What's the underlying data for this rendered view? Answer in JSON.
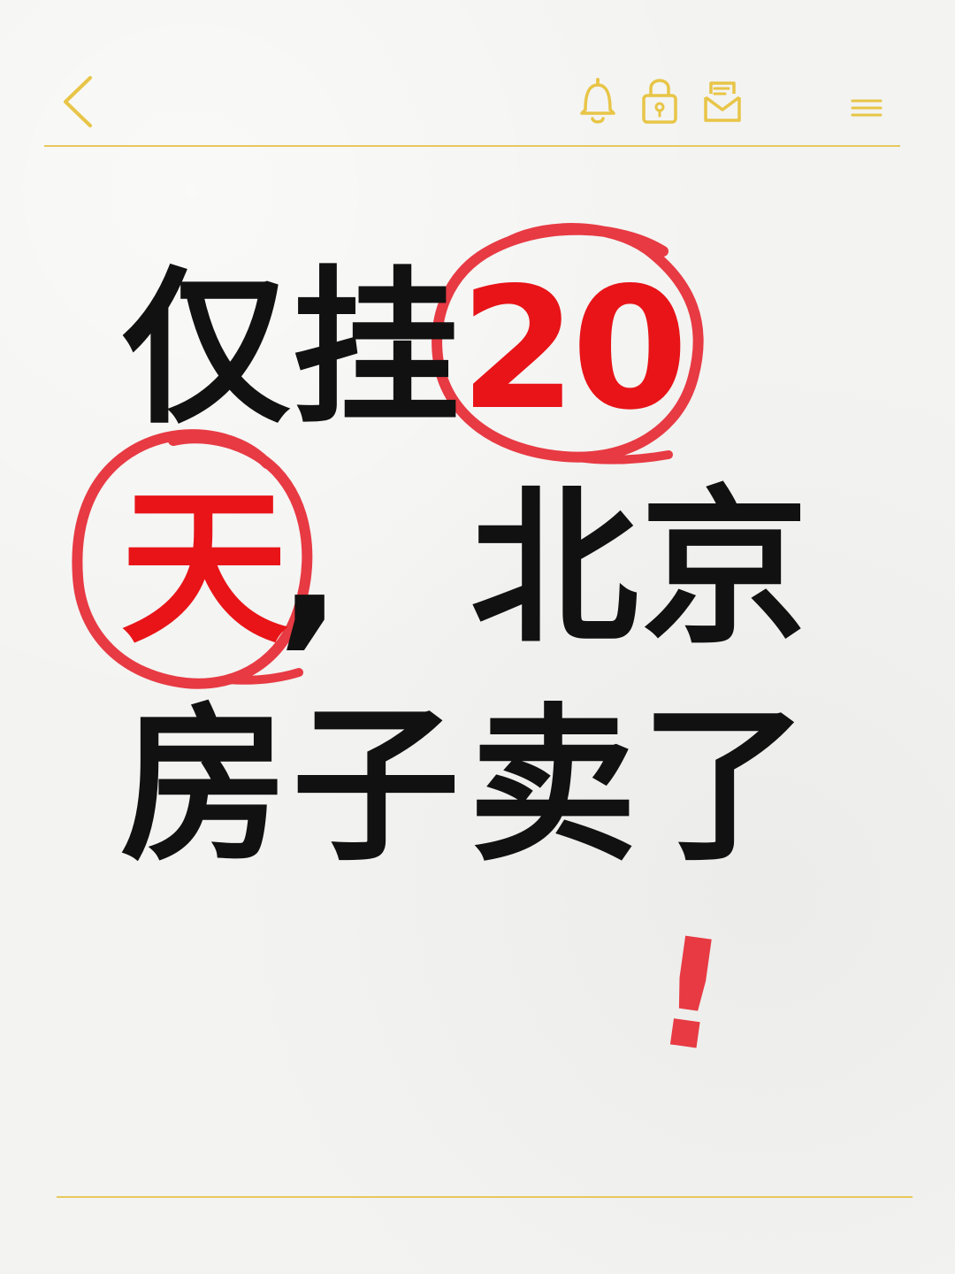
{
  "header": {
    "back_icon": "chevron-left-icon",
    "notification_icon": "bell-icon",
    "lock_icon": "lock-icon",
    "mail_icon": "mail-icon",
    "menu_icon": "menu-icon",
    "icon_color": "#e8c547"
  },
  "content": {
    "line1": {
      "char1": "仅",
      "char2": "挂",
      "number": "20"
    },
    "line2": {
      "char1": "天",
      "comma": ",",
      "char3": "北",
      "char4": "京"
    },
    "line3": {
      "char1": "房",
      "char2": "子",
      "char3": "卖",
      "char4": "了"
    },
    "exclamation": "!"
  },
  "colors": {
    "text_black": "#111111",
    "text_red": "#e81418",
    "annotation_red": "#e73a43",
    "rule_gold": "#e7c85c"
  }
}
